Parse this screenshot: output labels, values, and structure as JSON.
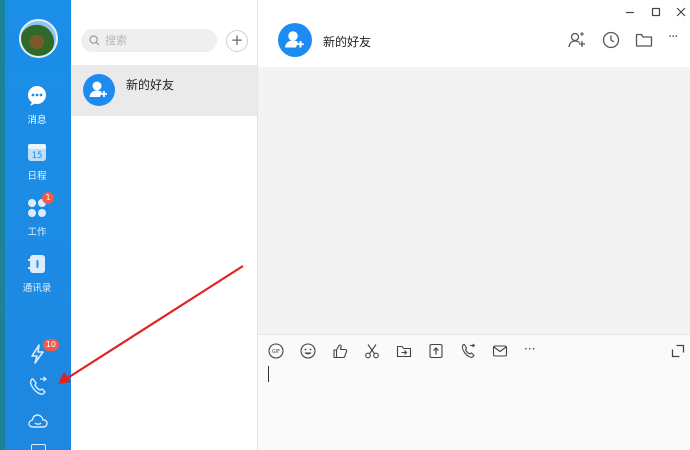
{
  "nav": {
    "items": [
      {
        "label": "消息",
        "icon": "chat-bubble-icon"
      },
      {
        "label": "日程",
        "icon": "calendar-icon",
        "day": "15"
      },
      {
        "label": "工作",
        "icon": "apps-grid-icon",
        "badge": "1"
      },
      {
        "label": "通讯录",
        "icon": "contacts-icon"
      }
    ],
    "bottom": [
      {
        "icon": "lightning-icon",
        "badge": "10"
      },
      {
        "icon": "phone-call-icon"
      },
      {
        "icon": "cloud-icon"
      }
    ]
  },
  "panel": {
    "search_placeholder": "搜索",
    "add_label": "+",
    "list": [
      {
        "name": "新的好友",
        "icon": "add-friend-icon"
      }
    ]
  },
  "chat": {
    "title": "新的好友",
    "header_icons": [
      "add-person-icon",
      "history-clock-icon",
      "folder-icon",
      "more-icon"
    ],
    "window_controls": [
      "minimize-icon",
      "maximize-icon",
      "close-icon"
    ],
    "toolbar": [
      "gif-icon",
      "emoji-icon",
      "thumbs-up-icon",
      "scissors-icon",
      "file-transfer-icon",
      "upload-icon",
      "phone-call-icon",
      "mail-icon",
      "more-icon"
    ],
    "gif_label": "GIF",
    "more_label": "···"
  },
  "colors": {
    "nav_bg": "#1a8fe8",
    "accent": "#1d8cf0",
    "badge": "#f25a4a",
    "arrow": "#e02222"
  }
}
